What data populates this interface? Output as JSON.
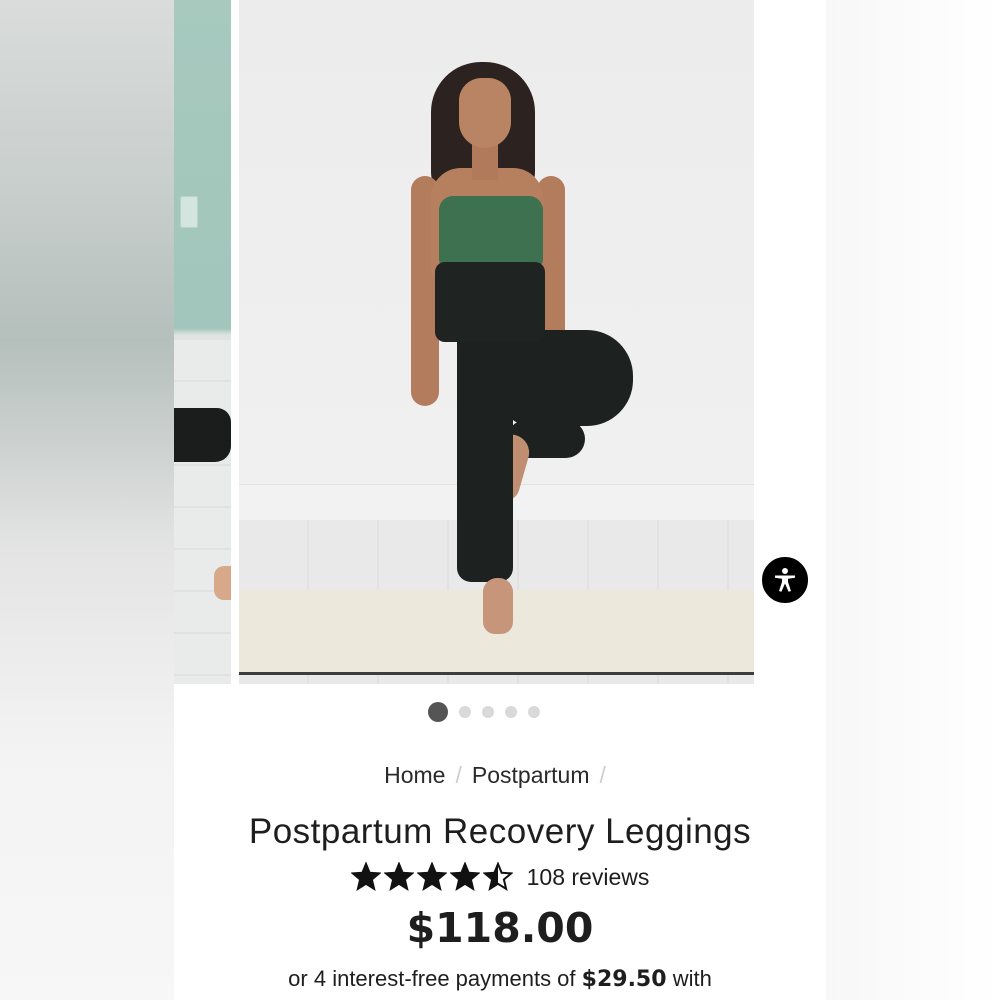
{
  "carousel": {
    "slide_count": 5,
    "active_index": 0
  },
  "breadcrumb": {
    "items": [
      "Home",
      "Postpartum"
    ],
    "separator": "/"
  },
  "product": {
    "title": "Postpartum Recovery Leggings",
    "rating": 4.5,
    "rating_max": 5,
    "reviews_label": "108 reviews",
    "price": "$118.00",
    "installments_prefix": "or 4 interest-free payments of",
    "installment_amount": "$29.50",
    "installments_suffix": "with"
  },
  "accessibility": {
    "icon": "accessibility-person-icon"
  },
  "colors": {
    "active_dot": "#555555",
    "inactive_dot": "#d9d9d9",
    "top_green": "#3d7150"
  }
}
